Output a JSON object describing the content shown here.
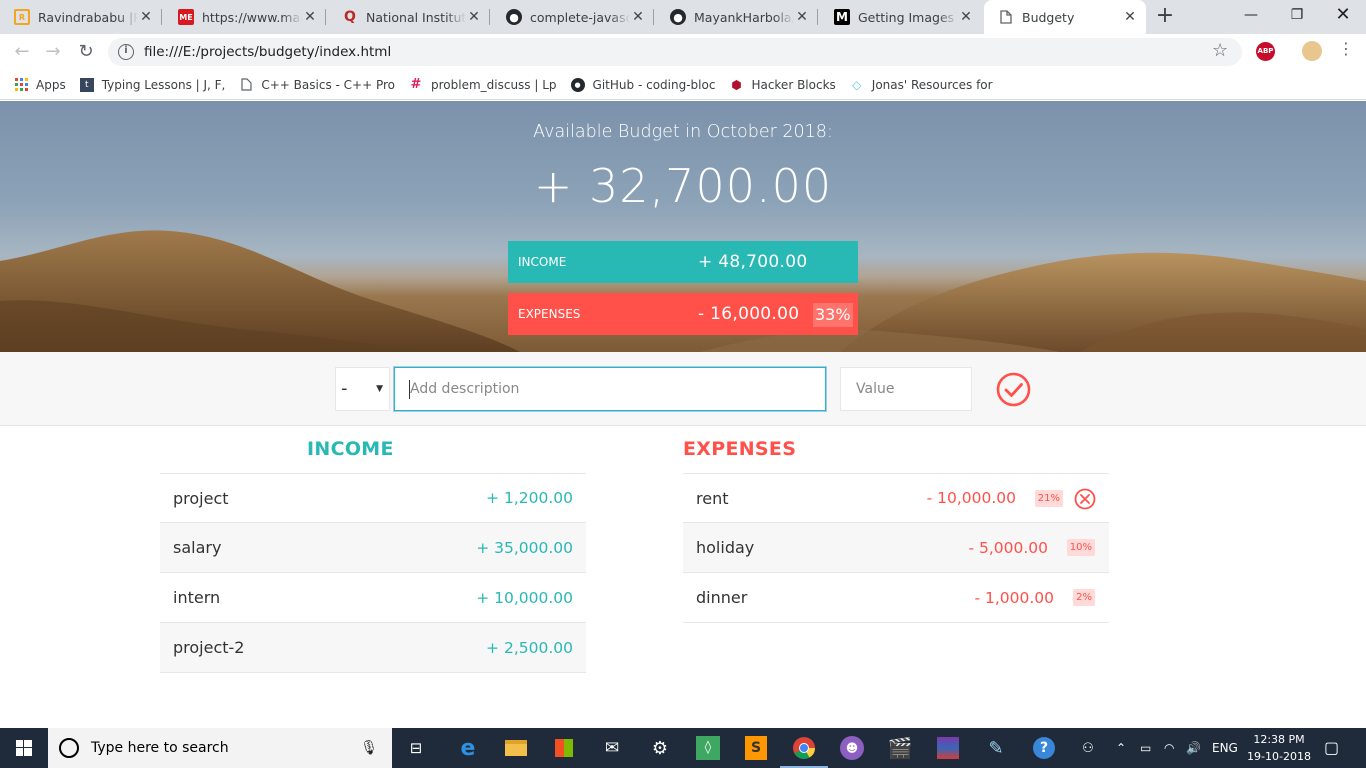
{
  "browser": {
    "tabs": [
      {
        "title": "Ravindrababu |Rav",
        "icon": "ravindrababu-icon",
        "color": "#f3a521"
      },
      {
        "title": "https://www.made",
        "icon": "madeeasy-icon",
        "color": "#d71920"
      },
      {
        "title": "National Institute o",
        "icon": "quora-icon",
        "color": "#b92b27"
      },
      {
        "title": "complete-javascrip",
        "icon": "github-icon",
        "color": "#24292e"
      },
      {
        "title": "MayankHarbola/Le",
        "icon": "github-icon",
        "color": "#24292e"
      },
      {
        "title": "Getting Images int",
        "icon": "medium-icon",
        "color": "#000000"
      },
      {
        "title": "Budgety",
        "icon": "page-icon",
        "color": "#5f6368"
      }
    ],
    "new_tab": "+",
    "url": "file:///E:/projects/budgety/index.html",
    "abp_label": "ABP",
    "bookmarks": [
      {
        "label": "Apps",
        "icon": "apps-grid-icon"
      },
      {
        "label": "Typing Lessons | J, F,",
        "icon": "tumblr-icon"
      },
      {
        "label": "C++ Basics - C++ Pro",
        "icon": "page-icon"
      },
      {
        "label": "problem_discuss | Lp",
        "icon": "slack-icon"
      },
      {
        "label": "GitHub - coding-bloc",
        "icon": "github-icon"
      },
      {
        "label": "Hacker Blocks",
        "icon": "hackerblocks-icon"
      },
      {
        "label": "Jonas' Resources for",
        "icon": "diamond-icon"
      }
    ]
  },
  "budget": {
    "title_prefix": "Available Budget in ",
    "month": "October 2018",
    "title_suffix": ":",
    "value": "+ 32,700.00",
    "income_label": "Income",
    "income_value": "+ 48,700.00",
    "expenses_label": "Expenses",
    "expenses_value": "- 16,000.00",
    "expenses_percentage": "33%"
  },
  "add_form": {
    "type_value": "-",
    "description_placeholder": "Add description",
    "value_placeholder": "Value"
  },
  "income": {
    "title": "Income",
    "items": [
      {
        "description": "project",
        "value": "+ 1,200.00"
      },
      {
        "description": "salary",
        "value": "+ 35,000.00"
      },
      {
        "description": "intern",
        "value": "+ 10,000.00"
      },
      {
        "description": "project-2",
        "value": "+ 2,500.00"
      }
    ]
  },
  "expenses": {
    "title": "Expenses",
    "items": [
      {
        "description": "rent",
        "value": "- 10,000.00",
        "percentage": "21%"
      },
      {
        "description": "holiday",
        "value": "- 5,000.00",
        "percentage": "10%"
      },
      {
        "description": "dinner",
        "value": "- 1,000.00",
        "percentage": "2%"
      }
    ]
  },
  "colors": {
    "income": "#28b9b5",
    "expense": "#ff5049"
  },
  "taskbar": {
    "search_placeholder": "Type here to search",
    "language": "ENG",
    "time": "12:38 PM",
    "date": "19-10-2018"
  }
}
